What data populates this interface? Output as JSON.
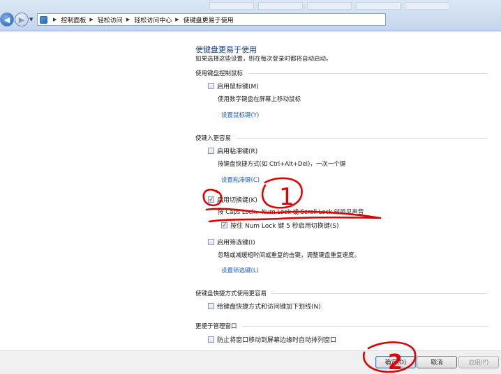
{
  "breadcrumb": {
    "items": [
      "控制面板",
      "轻松访问",
      "轻松访问中心",
      "使键盘更易于使用"
    ],
    "separator": "▶"
  },
  "page": {
    "title": "使键盘更易于使用",
    "subtitle": "如果选择这些设置，则在每次登录时都将自动启动。"
  },
  "sections": {
    "mouse": {
      "heading": "使用键盘控制鼠标",
      "mouse_keys": {
        "label": "启用鼠标键(M)",
        "checked": false
      },
      "mouse_keys_desc": "使用数字键盘在屏幕上移动鼠标",
      "mouse_keys_link": "设置鼠标键(Y)"
    },
    "typing": {
      "heading": "使键入更容易",
      "sticky_keys": {
        "label": "启用粘滞键(R)",
        "checked": false
      },
      "sticky_keys_desc": "按键盘快捷方式(如 Ctrl+Alt+Del)，一次一个键",
      "sticky_keys_link": "设置粘滞键(C)",
      "toggle_keys": {
        "label": "启用切换键(K)",
        "checked": true
      },
      "toggle_keys_desc": "按 Caps Lock、Num Lock 或 Scroll Lock 时听见声音",
      "toggle_keys_sub": {
        "label": "按住 Num Lock 键 5 秒启用切换键(S)",
        "checked": true
      },
      "filter_keys": {
        "label": "启用筛选键(I)",
        "checked": false
      },
      "filter_keys_desc": "忽略或减缓短时间或重复的击键，调整键盘重复速度。",
      "filter_keys_link": "设置筛选键(L)"
    },
    "shortcuts": {
      "heading": "使键盘快捷方式使用更容易",
      "underline": {
        "label": "给键盘快捷方式和访问键加下划线(N)",
        "checked": false
      }
    },
    "windows": {
      "heading": "更便于管理窗口",
      "arrange": {
        "label": "防止将窗口移动到屏幕边缘时自动排列窗口",
        "checked": false
      }
    }
  },
  "buttons": {
    "ok": "确定(O)",
    "cancel": "取消",
    "apply": "应用(P)"
  },
  "annotations": {
    "mark_1": "1",
    "mark_2": "2",
    "color": "#e00000"
  }
}
